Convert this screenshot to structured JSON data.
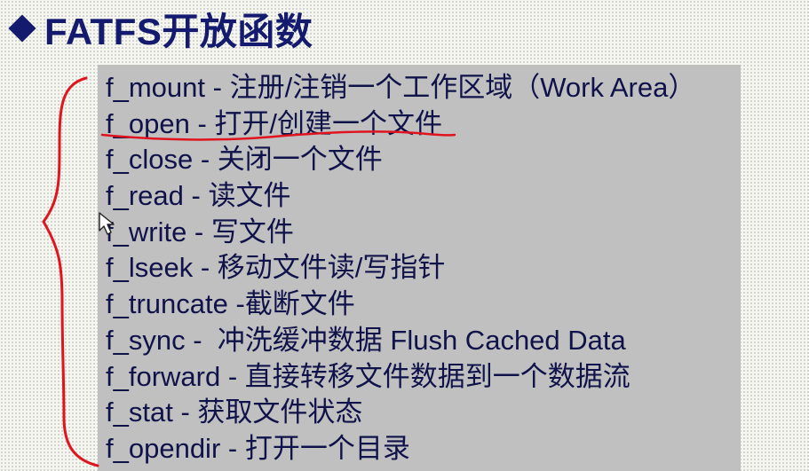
{
  "slide": {
    "title": "FATFS开放函数"
  },
  "functions": [
    {
      "name": "f_mount",
      "sep": " - ",
      "desc": "注册/注销一个工作区域（Work Area）"
    },
    {
      "name": "f_open",
      "sep": " - ",
      "desc": "打开/创建一个文件"
    },
    {
      "name": "f_close",
      "sep": " - ",
      "desc": "关闭一个文件"
    },
    {
      "name": "f_read",
      "sep": " - ",
      "desc": "读文件"
    },
    {
      "name": "f_write",
      "sep": " - ",
      "desc": "写文件"
    },
    {
      "name": "f_lseek",
      "sep": " - ",
      "desc": "移动文件读/写指针"
    },
    {
      "name": "f_truncate",
      "sep": " -",
      "desc": "截断文件"
    },
    {
      "name": "f_sync",
      "sep": " -  ",
      "desc": "冲洗缓冲数据 Flush Cached Data"
    },
    {
      "name": "f_forward",
      "sep": " - ",
      "desc": "直接转移文件数据到一个数据流"
    },
    {
      "name": "f_stat",
      "sep": " - ",
      "desc": "获取文件状态"
    },
    {
      "name": "f_opendir",
      "sep": " - ",
      "desc": "打开一个目录"
    }
  ],
  "colors": {
    "title": "#141a6e",
    "text": "#10124a",
    "box": "#c0c0c0",
    "annotation": "#e0141e"
  },
  "icons": {
    "title_bullet": "diamond-bullet-icon",
    "cursor": "mouse-pointer-icon"
  }
}
